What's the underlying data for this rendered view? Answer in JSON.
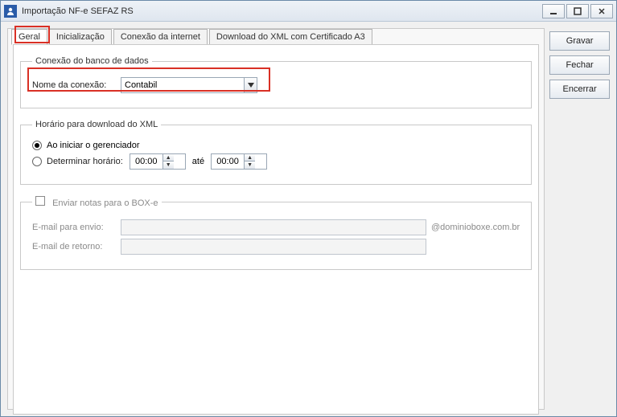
{
  "window": {
    "title": "Importação NF-e SEFAZ RS"
  },
  "tabs": {
    "geral": "Geral",
    "inicializacao": "Inicialização",
    "conexao_internet": "Conexão da internet",
    "download_xml": "Download do XML com Certificado A3"
  },
  "group_db": {
    "legend": "Conexão do banco de dados",
    "label": "Nome da conexão:",
    "value": "Contabil"
  },
  "group_schedule": {
    "legend": "Horário para download do XML",
    "opt_start": "Ao iniciar o gerenciador",
    "opt_time": "Determinar horário:",
    "time_from": "00:00",
    "ate": "até",
    "time_to": "00:00"
  },
  "group_boxe": {
    "legend": "Enviar notas para o BOX-e",
    "email_envio_label": "E-mail para envio:",
    "email_envio_value": "",
    "email_suffix": "@dominioboxe.com.br",
    "email_retorno_label": "E-mail de retorno:",
    "email_retorno_value": ""
  },
  "buttons": {
    "gravar": "Gravar",
    "fechar": "Fechar",
    "encerrar": "Encerrar"
  }
}
